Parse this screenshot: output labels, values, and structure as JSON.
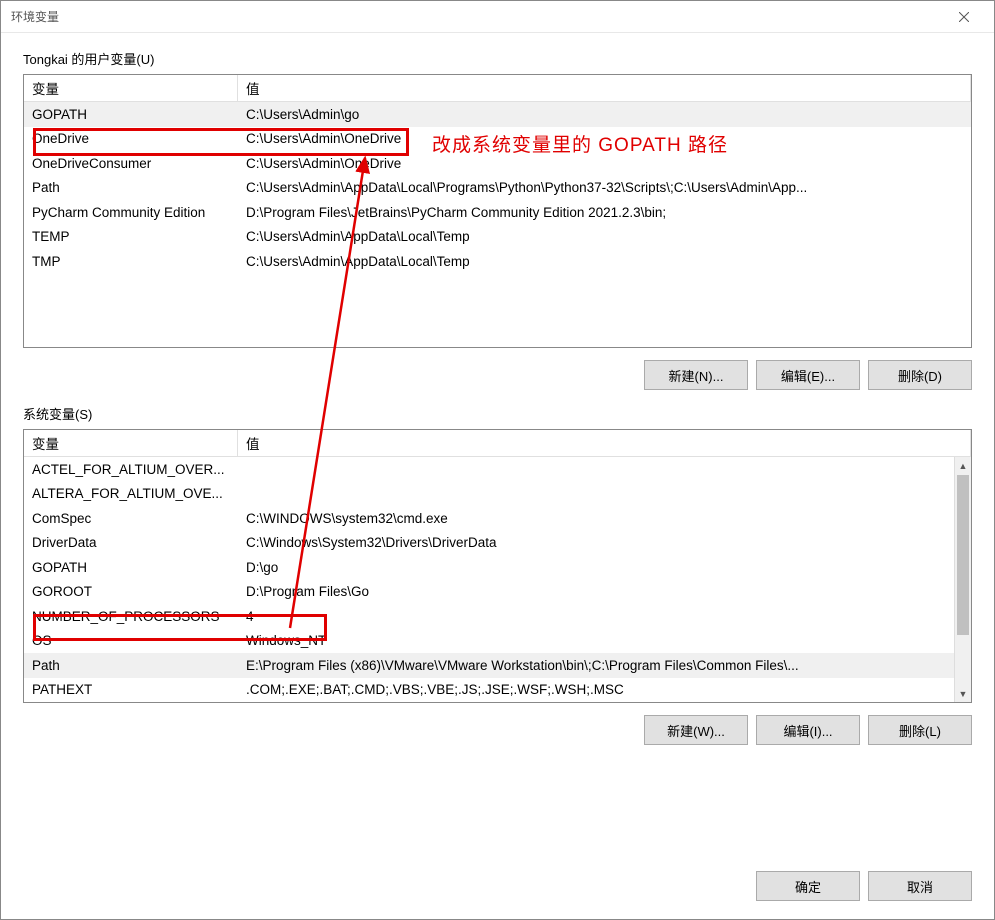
{
  "title": "环境变量",
  "annotation_text": "改成系统变量里的 GOPATH 路径",
  "user_section": {
    "label": "Tongkai 的用户变量(U)",
    "headers": {
      "name": "变量",
      "value": "值"
    },
    "rows": [
      {
        "name": "GOPATH",
        "value": "C:\\Users\\Admin\\go",
        "selected": true
      },
      {
        "name": "OneDrive",
        "value": "C:\\Users\\Admin\\OneDrive"
      },
      {
        "name": "OneDriveConsumer",
        "value": "C:\\Users\\Admin\\OneDrive"
      },
      {
        "name": "Path",
        "value": "C:\\Users\\Admin\\AppData\\Local\\Programs\\Python\\Python37-32\\Scripts\\;C:\\Users\\Admin\\App..."
      },
      {
        "name": "PyCharm Community Edition",
        "value": "D:\\Program Files\\JetBrains\\PyCharm Community Edition 2021.2.3\\bin;"
      },
      {
        "name": "TEMP",
        "value": "C:\\Users\\Admin\\AppData\\Local\\Temp"
      },
      {
        "name": "TMP",
        "value": "C:\\Users\\Admin\\AppData\\Local\\Temp"
      }
    ],
    "buttons": {
      "new": "新建(N)...",
      "edit": "编辑(E)...",
      "delete": "删除(D)"
    }
  },
  "sys_section": {
    "label": "系统变量(S)",
    "headers": {
      "name": "变量",
      "value": "值"
    },
    "rows": [
      {
        "name": "ACTEL_FOR_ALTIUM_OVER...",
        "value": ""
      },
      {
        "name": "ALTERA_FOR_ALTIUM_OVE...",
        "value": ""
      },
      {
        "name": "ComSpec",
        "value": "C:\\WINDOWS\\system32\\cmd.exe"
      },
      {
        "name": "DriverData",
        "value": "C:\\Windows\\System32\\Drivers\\DriverData"
      },
      {
        "name": "GOPATH",
        "value": "D:\\go"
      },
      {
        "name": "GOROOT",
        "value": "D:\\Program Files\\Go"
      },
      {
        "name": "NUMBER_OF_PROCESSORS",
        "value": "4"
      },
      {
        "name": "OS",
        "value": "Windows_NT"
      },
      {
        "name": "Path",
        "value": "E:\\Program Files (x86)\\VMware\\VMware Workstation\\bin\\;C:\\Program Files\\Common Files\\...",
        "selected": true
      },
      {
        "name": "PATHEXT",
        "value": ".COM;.EXE;.BAT;.CMD;.VBS;.VBE;.JS;.JSE;.WSF;.WSH;.MSC"
      }
    ],
    "buttons": {
      "new": "新建(W)...",
      "edit": "编辑(I)...",
      "delete": "删除(L)"
    }
  },
  "footer": {
    "ok": "确定",
    "cancel": "取消"
  }
}
